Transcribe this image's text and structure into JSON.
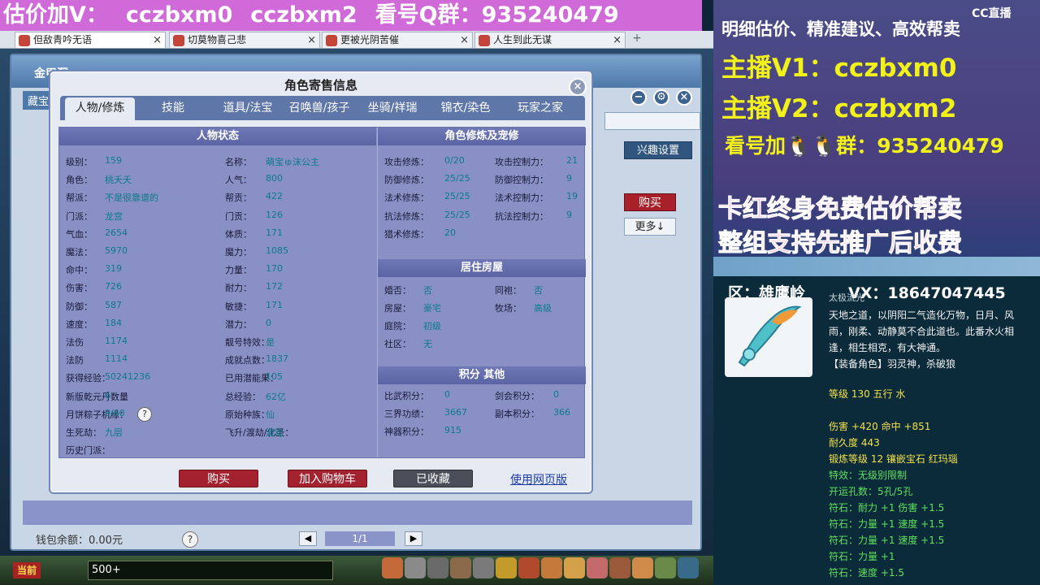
{
  "banner": {
    "parts": [
      "估价加V：",
      "cczbxm0",
      "cczbxm2",
      "看号Q群：935240479"
    ]
  },
  "browser_tabs": [
    {
      "label": "但敌青吟无语"
    },
    {
      "label": "切莫物喜己悲"
    },
    {
      "label": "更被光阴苦催"
    },
    {
      "label": "人生到此无谋"
    }
  ],
  "game": {
    "location_tag": "金甲洞",
    "side_tag": "藏宝",
    "interest_btn": "兴趣设置",
    "buy_side": "购买",
    "more_side": "更多↓",
    "wallet": "钱包余额：0.00元",
    "page": "1/1",
    "chat_tag": "当前",
    "chat_count": "500+"
  },
  "modal": {
    "title": "角色寄售信息",
    "tabs": [
      "人物/修炼",
      "技能",
      "道具/法宝",
      "召唤兽/孩子",
      "坐骑/祥瑞",
      "锦衣/染色",
      "玩家之家"
    ],
    "sections": {
      "status": "人物状态",
      "cultivation": "角色修炼及宠修",
      "house": "居住房屋",
      "points": "积分 其他"
    },
    "status_left": [
      {
        "k": "级别：",
        "v": "159"
      },
      {
        "k": "角色：",
        "v": "桃夭夭"
      },
      {
        "k": "帮派：",
        "v": "不是很靠谱的"
      },
      {
        "k": "门派：",
        "v": "龙宫"
      },
      {
        "k": "气血：",
        "v": "2654"
      },
      {
        "k": "魔法：",
        "v": "5970"
      },
      {
        "k": "命中：",
        "v": "319"
      },
      {
        "k": "伤害：",
        "v": "726"
      },
      {
        "k": "防御：",
        "v": "587"
      },
      {
        "k": "速度：",
        "v": "184"
      },
      {
        "k": "法伤",
        "v": "1174"
      },
      {
        "k": "法防",
        "v": "1114"
      },
      {
        "k": "获得经验：",
        "v": "50241236"
      },
      {
        "k": "新版乾元丹数量",
        "v": "6"
      },
      {
        "k": "月饼粽子机缘：",
        "v": "9/60"
      },
      {
        "k": "生死劫：",
        "v": "九层"
      },
      {
        "k": "历史门派：",
        "v": ""
      }
    ],
    "status_right": [
      {
        "k": "名称：",
        "v": "萌宝ゅ沫公主"
      },
      {
        "k": "人气：",
        "v": "800"
      },
      {
        "k": "帮贡：",
        "v": "422"
      },
      {
        "k": "门贡：",
        "v": "126"
      },
      {
        "k": "体质：",
        "v": "171"
      },
      {
        "k": "魔力：",
        "v": "1085"
      },
      {
        "k": "力量：",
        "v": "170"
      },
      {
        "k": "耐力：",
        "v": "172"
      },
      {
        "k": "敏捷：",
        "v": "171"
      },
      {
        "k": "潜力：",
        "v": "0"
      },
      {
        "k": "靓号特效：",
        "v": "是"
      },
      {
        "k": "成就点数：",
        "v": "1837"
      },
      {
        "k": "已用潜能果：",
        "v": "105"
      },
      {
        "k": "总经验：",
        "v": "62亿"
      },
      {
        "k": "原始种族：",
        "v": "仙"
      },
      {
        "k": "飞升/渡劫/化圣：",
        "v": "渡劫"
      }
    ],
    "cult_left": [
      {
        "k": "攻击修炼：",
        "v": "0/20"
      },
      {
        "k": "防御修炼：",
        "v": "25/25"
      },
      {
        "k": "法术修炼：",
        "v": "25/25"
      },
      {
        "k": "抗法修炼：",
        "v": "25/25"
      },
      {
        "k": "猎术修炼：",
        "v": "20"
      }
    ],
    "cult_right": [
      {
        "k": "攻击控制力：",
        "v": "21"
      },
      {
        "k": "防御控制力：",
        "v": "9"
      },
      {
        "k": "法术控制力：",
        "v": "19"
      },
      {
        "k": "抗法控制力：",
        "v": "9"
      }
    ],
    "house_left": [
      {
        "k": "婚否：",
        "v": "否"
      },
      {
        "k": "房屋：",
        "v": "豪宅"
      },
      {
        "k": "庭院：",
        "v": "初级"
      },
      {
        "k": "社区：",
        "v": "无"
      }
    ],
    "house_right": [
      {
        "k": "同袍：",
        "v": "否"
      },
      {
        "k": "牧场：",
        "v": "高级"
      }
    ],
    "points_left": [
      {
        "k": "比武积分：",
        "v": "0"
      },
      {
        "k": "三界功绩：",
        "v": "3667"
      },
      {
        "k": "神器积分：",
        "v": "915"
      }
    ],
    "points_right": [
      {
        "k": "剑会积分：",
        "v": "0"
      },
      {
        "k": "副本积分：",
        "v": "366"
      }
    ],
    "buttons": {
      "buy": "购买",
      "cart": "加入购物车",
      "fav": "已收藏",
      "web": "使用网页版"
    }
  },
  "stream": {
    "cc_logo": "CC直播",
    "line1": "明细估价、精准建议、高效帮卖",
    "line2": "主播V1：cczbxm0",
    "line3": "主播V2：cczbxm2",
    "line4": "看号加🐧🐧群：935240479",
    "line5": "卡红终身免费估价帮卖",
    "line6": "整组支持先推广后收费",
    "server": "区：雄鹰岭",
    "vx": "VX：18647047445",
    "item": {
      "name": "太极流光",
      "desc": "天地之道，以阴阳二气造化万物，日月、风雨，刚柔、动静莫不合此道也。此番水火相逢，相生相克，有大神通。",
      "role": "【装备角色】羽灵神，杀破狼",
      "stats": [
        {
          "t": "等级 130 五行 水",
          "c": "y"
        },
        {
          "t": "伤害 +420 命中 +851",
          "c": "y"
        },
        {
          "t": "耐久度 443",
          "c": "y"
        },
        {
          "t": "锻炼等级 12 镶嵌宝石 红玛瑙",
          "c": "y"
        },
        {
          "t": "特效：无级别限制",
          "c": "g"
        },
        {
          "t": "开运孔数：5孔/5孔",
          "c": "g"
        },
        {
          "t": "符石：耐力 +1 伤害 +1.5",
          "c": "g"
        },
        {
          "t": "符石：力量 +1 速度 +1.5",
          "c": "g"
        },
        {
          "t": "符石：力量 +1 速度 +1.5",
          "c": "g"
        },
        {
          "t": "符石：力量 +1",
          "c": "g"
        },
        {
          "t": "符石：速度 +1.5",
          "c": "g"
        }
      ]
    }
  },
  "colors": {
    "accent_red": "#a42230",
    "panel_purple": "#8890c4",
    "value_teal": "#0c7a88",
    "stream_yellow": "#f2f21a",
    "stream_pink": "#ff4aa0"
  }
}
